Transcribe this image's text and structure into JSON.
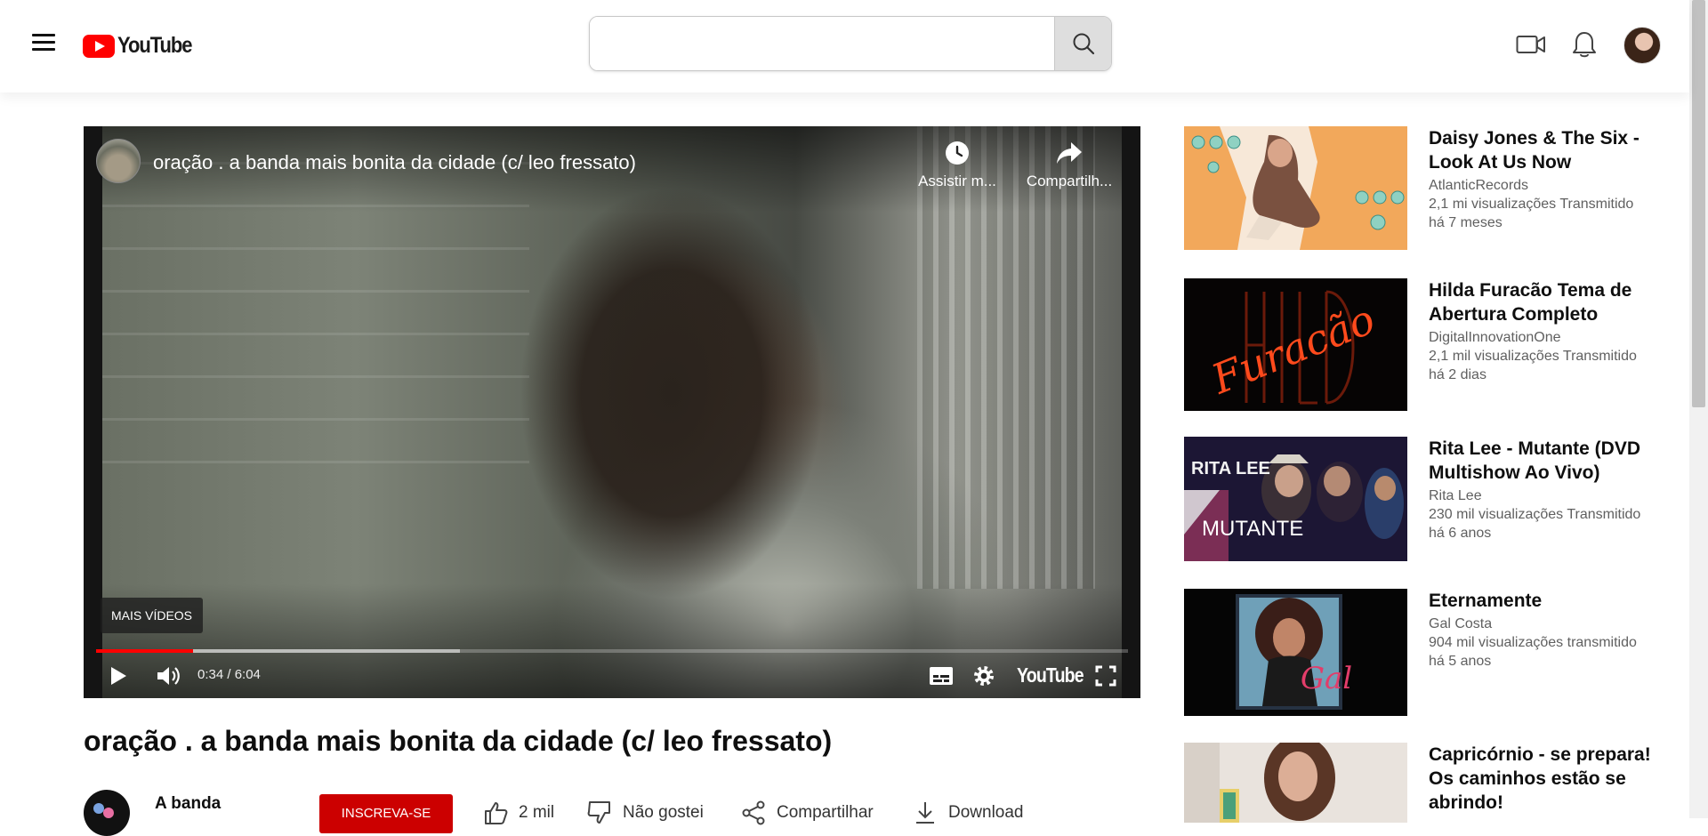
{
  "header": {
    "logo_text": "YouTube",
    "search_placeholder": "",
    "icons": [
      "menu-icon",
      "search-icon",
      "video-camera-icon",
      "bell-icon"
    ]
  },
  "player": {
    "overlay_title": "oração . a banda mais bonita da cidade (c/ leo fressato)",
    "watch_later_label": "Assistir m...",
    "share_label": "Compartilh...",
    "more_videos_label": "MAIS VÍDEOS",
    "current_time": "0:34",
    "duration": "6:04",
    "time_text": "0:34 / 6:04",
    "played_fraction": 0.094,
    "buffered_fraction": 0.353,
    "brand_label": "YouTube",
    "colors": {
      "progress": "#ff0000"
    }
  },
  "video": {
    "title": "oração . a banda mais bonita da cidade (c/ leo fressato)",
    "channel_name": "A banda",
    "subscribe_label": "INSCREVA-SE",
    "actions": {
      "like_count": "2 mil",
      "dislike_label": "Não gostei",
      "share_label": "Compartilhar",
      "download_label": "Download"
    }
  },
  "recommendations": [
    {
      "title": "Daisy Jones & The Six - Look At Us Now",
      "channel": "AtlanticRecords",
      "views": "2,1 mi visualizações Transmitido",
      "age": "há 7 meses"
    },
    {
      "title": "Hilda Furacão Tema de Abertura Completo",
      "channel": "DigitalInnovationOne",
      "views": "2,1 mil visualizações Transmitido",
      "age": "há 2 dias",
      "thumb_text": "Furacão"
    },
    {
      "title": "Rita Lee - Mutante (DVD Multishow Ao Vivo)",
      "channel": "Rita Lee",
      "views": "230 mil visualizações Transmitido",
      "age": "há 6 anos",
      "thumb_text_top": "RITA LEE",
      "thumb_text": "MUTANTE"
    },
    {
      "title": "Eternamente",
      "channel": "Gal Costa",
      "views": "904 mil visualizações transmitido",
      "age": "há 5 anos",
      "thumb_text": "Gal"
    },
    {
      "title": "Capricórnio - se prepara! Os caminhos estão se abrindo!",
      "channel": "",
      "views": "",
      "age": ""
    }
  ]
}
